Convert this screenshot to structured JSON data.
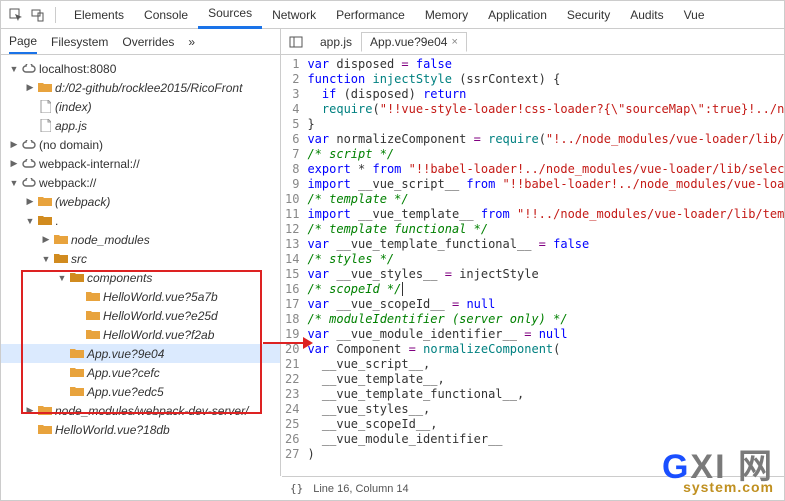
{
  "toolbar_tabs": [
    "Elements",
    "Console",
    "Sources",
    "Network",
    "Performance",
    "Memory",
    "Application",
    "Security",
    "Audits",
    "Vue"
  ],
  "toolbar_active": "Sources",
  "side_tabs": [
    "Page",
    "Filesystem",
    "Overrides",
    "»"
  ],
  "side_active": "Page",
  "editor_tabs": [
    {
      "label": "app.js",
      "active": false
    },
    {
      "label": "App.vue?9e04",
      "active": true
    }
  ],
  "tree": [
    {
      "d": 0,
      "t": "▼",
      "ic": "cloud",
      "l": "localhost:8080"
    },
    {
      "d": 1,
      "t": "▶",
      "ic": "fld",
      "l": "d:/02-github/rocklee2015/RicoFront",
      "it": true
    },
    {
      "d": 1,
      "t": "",
      "ic": "file",
      "l": "(index)",
      "it": true
    },
    {
      "d": 1,
      "t": "",
      "ic": "file",
      "l": "app.js",
      "it": true
    },
    {
      "d": 0,
      "t": "▶",
      "ic": "cloud",
      "l": "(no domain)"
    },
    {
      "d": 0,
      "t": "▶",
      "ic": "cloud",
      "l": "webpack-internal://"
    },
    {
      "d": 0,
      "t": "▼",
      "ic": "cloud",
      "l": "webpack://"
    },
    {
      "d": 1,
      "t": "▶",
      "ic": "fld",
      "l": "(webpack)",
      "it": true
    },
    {
      "d": 1,
      "t": "▼",
      "ic": "fld-dk",
      "l": "."
    },
    {
      "d": 2,
      "t": "▶",
      "ic": "fld",
      "l": "node_modules",
      "it": true
    },
    {
      "d": 2,
      "t": "▼",
      "ic": "fld-dk",
      "l": "src",
      "it": true
    },
    {
      "d": 3,
      "t": "▼",
      "ic": "fld-dk",
      "l": "components",
      "it": true
    },
    {
      "d": 4,
      "t": "",
      "ic": "fld",
      "l": "HelloWorld.vue?5a7b",
      "it": true
    },
    {
      "d": 4,
      "t": "",
      "ic": "fld",
      "l": "HelloWorld.vue?e25d",
      "it": true
    },
    {
      "d": 4,
      "t": "",
      "ic": "fld",
      "l": "HelloWorld.vue?f2ab",
      "it": true
    },
    {
      "d": 3,
      "t": "",
      "ic": "fld",
      "l": "App.vue?9e04",
      "it": true,
      "sel": true
    },
    {
      "d": 3,
      "t": "",
      "ic": "fld",
      "l": "App.vue?cefc",
      "it": true
    },
    {
      "d": 3,
      "t": "",
      "ic": "fld",
      "l": "App.vue?edc5",
      "it": true
    },
    {
      "d": 1,
      "t": "▶",
      "ic": "fld",
      "l": "node_modules/webpack-dev-server/",
      "it": true
    },
    {
      "d": 1,
      "t": "",
      "ic": "fld",
      "l": "HelloWorld.vue?18db",
      "it": true
    }
  ],
  "code": [
    [
      {
        "c": "k-blue",
        "t": "var"
      },
      {
        "c": "",
        "t": " disposed "
      },
      {
        "c": "k-pur",
        "t": "="
      },
      {
        "c": "",
        "t": " "
      },
      {
        "c": "k-blue",
        "t": "false"
      }
    ],
    [
      {
        "c": "k-blue",
        "t": "function"
      },
      {
        "c": "",
        "t": " "
      },
      {
        "c": "k-teal",
        "t": "injectStyle"
      },
      {
        "c": "",
        "t": " (ssrContext) {"
      }
    ],
    [
      {
        "c": "",
        "t": "  "
      },
      {
        "c": "k-blue",
        "t": "if"
      },
      {
        "c": "",
        "t": " (disposed) "
      },
      {
        "c": "k-blue",
        "t": "return"
      }
    ],
    [
      {
        "c": "",
        "t": "  "
      },
      {
        "c": "k-teal",
        "t": "require"
      },
      {
        "c": "",
        "t": "("
      },
      {
        "c": "k-red",
        "t": "\"!!vue-style-loader!css-loader?{\\\"sourceMap\\\":true}!../node_"
      }
    ],
    [
      {
        "c": "",
        "t": "}"
      }
    ],
    [
      {
        "c": "k-blue",
        "t": "var"
      },
      {
        "c": "",
        "t": " normalizeComponent "
      },
      {
        "c": "k-pur",
        "t": "="
      },
      {
        "c": "",
        "t": " "
      },
      {
        "c": "k-teal",
        "t": "require"
      },
      {
        "c": "",
        "t": "("
      },
      {
        "c": "k-red",
        "t": "\"!../node_modules/vue-loader/lib/comp"
      }
    ],
    [
      {
        "c": "k-grn",
        "t": "/* script */"
      }
    ],
    [
      {
        "c": "k-blue",
        "t": "export"
      },
      {
        "c": "",
        "t": " * "
      },
      {
        "c": "k-blue",
        "t": "from"
      },
      {
        "c": "",
        "t": " "
      },
      {
        "c": "k-red",
        "t": "\"!!babel-loader!../node_modules/vue-loader/lib/selector?"
      }
    ],
    [
      {
        "c": "k-blue",
        "t": "import"
      },
      {
        "c": "",
        "t": " __vue_script__ "
      },
      {
        "c": "k-blue",
        "t": "from"
      },
      {
        "c": "",
        "t": " "
      },
      {
        "c": "k-red",
        "t": "\"!!babel-loader!../node_modules/vue-loader/"
      }
    ],
    [
      {
        "c": "k-grn",
        "t": "/* template */"
      }
    ],
    [
      {
        "c": "k-blue",
        "t": "import"
      },
      {
        "c": "",
        "t": " __vue_template__ "
      },
      {
        "c": "k-blue",
        "t": "from"
      },
      {
        "c": "",
        "t": " "
      },
      {
        "c": "k-red",
        "t": "\"!!../node_modules/vue-loader/lib/templat"
      }
    ],
    [
      {
        "c": "k-grn",
        "t": "/* template functional */"
      }
    ],
    [
      {
        "c": "k-blue",
        "t": "var"
      },
      {
        "c": "",
        "t": " __vue_template_functional__ "
      },
      {
        "c": "k-pur",
        "t": "="
      },
      {
        "c": "",
        "t": " "
      },
      {
        "c": "k-blue",
        "t": "false"
      }
    ],
    [
      {
        "c": "k-grn",
        "t": "/* styles */"
      }
    ],
    [
      {
        "c": "k-blue",
        "t": "var"
      },
      {
        "c": "",
        "t": " __vue_styles__ "
      },
      {
        "c": "k-pur",
        "t": "="
      },
      {
        "c": "",
        "t": " injectStyle"
      }
    ],
    [
      {
        "c": "k-grn",
        "t": "/* scopeId */",
        "caret": true
      }
    ],
    [
      {
        "c": "k-blue",
        "t": "var"
      },
      {
        "c": "",
        "t": " __vue_scopeId__ "
      },
      {
        "c": "k-pur",
        "t": "="
      },
      {
        "c": "",
        "t": " "
      },
      {
        "c": "k-blue",
        "t": "null"
      }
    ],
    [
      {
        "c": "k-grn",
        "t": "/* moduleIdentifier (server only) */"
      }
    ],
    [
      {
        "c": "k-blue",
        "t": "var"
      },
      {
        "c": "",
        "t": " __vue_module_identifier__ "
      },
      {
        "c": "k-pur",
        "t": "="
      },
      {
        "c": "",
        "t": " "
      },
      {
        "c": "k-blue",
        "t": "null"
      }
    ],
    [
      {
        "c": "k-blue",
        "t": "var"
      },
      {
        "c": "",
        "t": " Component "
      },
      {
        "c": "k-pur",
        "t": "="
      },
      {
        "c": "",
        "t": " "
      },
      {
        "c": "k-teal",
        "t": "normalizeComponent"
      },
      {
        "c": "",
        "t": "("
      }
    ],
    [
      {
        "c": "",
        "t": "  __vue_script__,"
      }
    ],
    [
      {
        "c": "",
        "t": "  __vue_template__,"
      }
    ],
    [
      {
        "c": "",
        "t": "  __vue_template_functional__,"
      }
    ],
    [
      {
        "c": "",
        "t": "  __vue_styles__,"
      }
    ],
    [
      {
        "c": "",
        "t": "  __vue_scopeId__,"
      }
    ],
    [
      {
        "c": "",
        "t": "  __vue_module_identifier__"
      }
    ],
    [
      {
        "c": "",
        "t": ")"
      }
    ]
  ],
  "status": {
    "braces": "{}",
    "pos": "Line 16, Column 14"
  },
  "watermark": {
    "top_blue": "G",
    "top_rest": "XI 网",
    "bottom": "system.com"
  }
}
